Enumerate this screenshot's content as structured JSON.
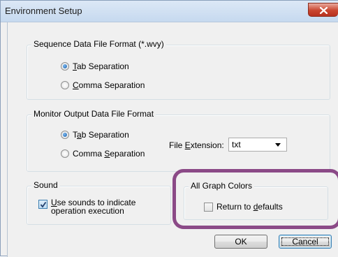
{
  "window": {
    "title": "Environment Setup",
    "close_icon": "close-icon"
  },
  "sequence_group": {
    "title": "Sequence Data File Format (*.wvy)",
    "options": [
      {
        "label": "Tab Separation",
        "mnemonic_char": "T",
        "rest": "ab Separation",
        "selected": true
      },
      {
        "label": "Comma Separation",
        "mnemonic_char": "C",
        "rest": "omma Separation",
        "selected": false
      }
    ]
  },
  "monitor_group": {
    "title": "Monitor Output Data File Format",
    "options": [
      {
        "label": "Tab Separation",
        "pre": "T",
        "mnemonic_char": "a",
        "rest": "b Separation",
        "selected": true
      },
      {
        "label": "Comma Separation",
        "pre": "Comma ",
        "mnemonic_char": "S",
        "rest": "eparation",
        "selected": false
      }
    ],
    "extension": {
      "label": "File Extension:",
      "pre": "File ",
      "mnemonic_char": "E",
      "rest": "xtension:",
      "value": "txt"
    }
  },
  "sound_group": {
    "title": "Sound",
    "checkbox": {
      "label": "Use sounds to indicate operation execution",
      "mnemonic_char": "U",
      "line1_rest": "se sounds to indicate",
      "line2": "operation execution",
      "checked": true
    }
  },
  "colors_group": {
    "title": "All Graph Colors",
    "checkbox": {
      "label": "Return to defaults",
      "pre": "Return to ",
      "mnemonic_char": "d",
      "rest": "efaults",
      "checked": false
    }
  },
  "buttons": {
    "ok": "OK",
    "cancel": "Cancel"
  },
  "colors": {
    "highlight": "#8b4a87",
    "radio_selected": "#1b5fa8",
    "close_button": "#c9452f"
  }
}
